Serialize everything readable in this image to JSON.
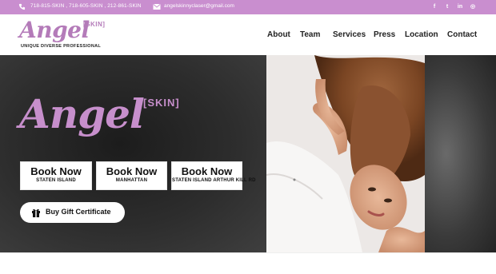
{
  "topbar": {
    "phones": "718-815-SKIN , 718-605-SKIN , 212-861-SKIN",
    "email": "angelskinnyclaser@gmail.com",
    "social": [
      {
        "icon": "facebook-icon",
        "glyph": "f"
      },
      {
        "icon": "twitter-icon",
        "glyph": "t"
      },
      {
        "icon": "linkedin-icon",
        "glyph": "in"
      },
      {
        "icon": "instagram-icon",
        "glyph": "◎"
      }
    ],
    "bg_color": "#c98ecf"
  },
  "logo": {
    "script": "Angel",
    "skin": "[SKIN]",
    "tagline": "UNIQUE   DIVERSE   PROFESSIONAL"
  },
  "nav": {
    "items": [
      "About",
      "Team",
      "Services",
      "Press",
      "Location",
      "Contact"
    ]
  },
  "hero": {
    "logo_script": "Angel",
    "logo_skin": "[SKIN]",
    "brand_color": "#c78fcc",
    "buttons": [
      {
        "title": "Book Now",
        "subtitle": "STATEN  ISLAND"
      },
      {
        "title": "Book Now",
        "subtitle": "MANHATTAN"
      },
      {
        "title": "Book Now",
        "subtitle": "STATEN ISLAND ARTHUR KILL RD"
      }
    ],
    "gift": {
      "label": "Buy Gift Certificate",
      "icon": "gift-icon"
    }
  }
}
